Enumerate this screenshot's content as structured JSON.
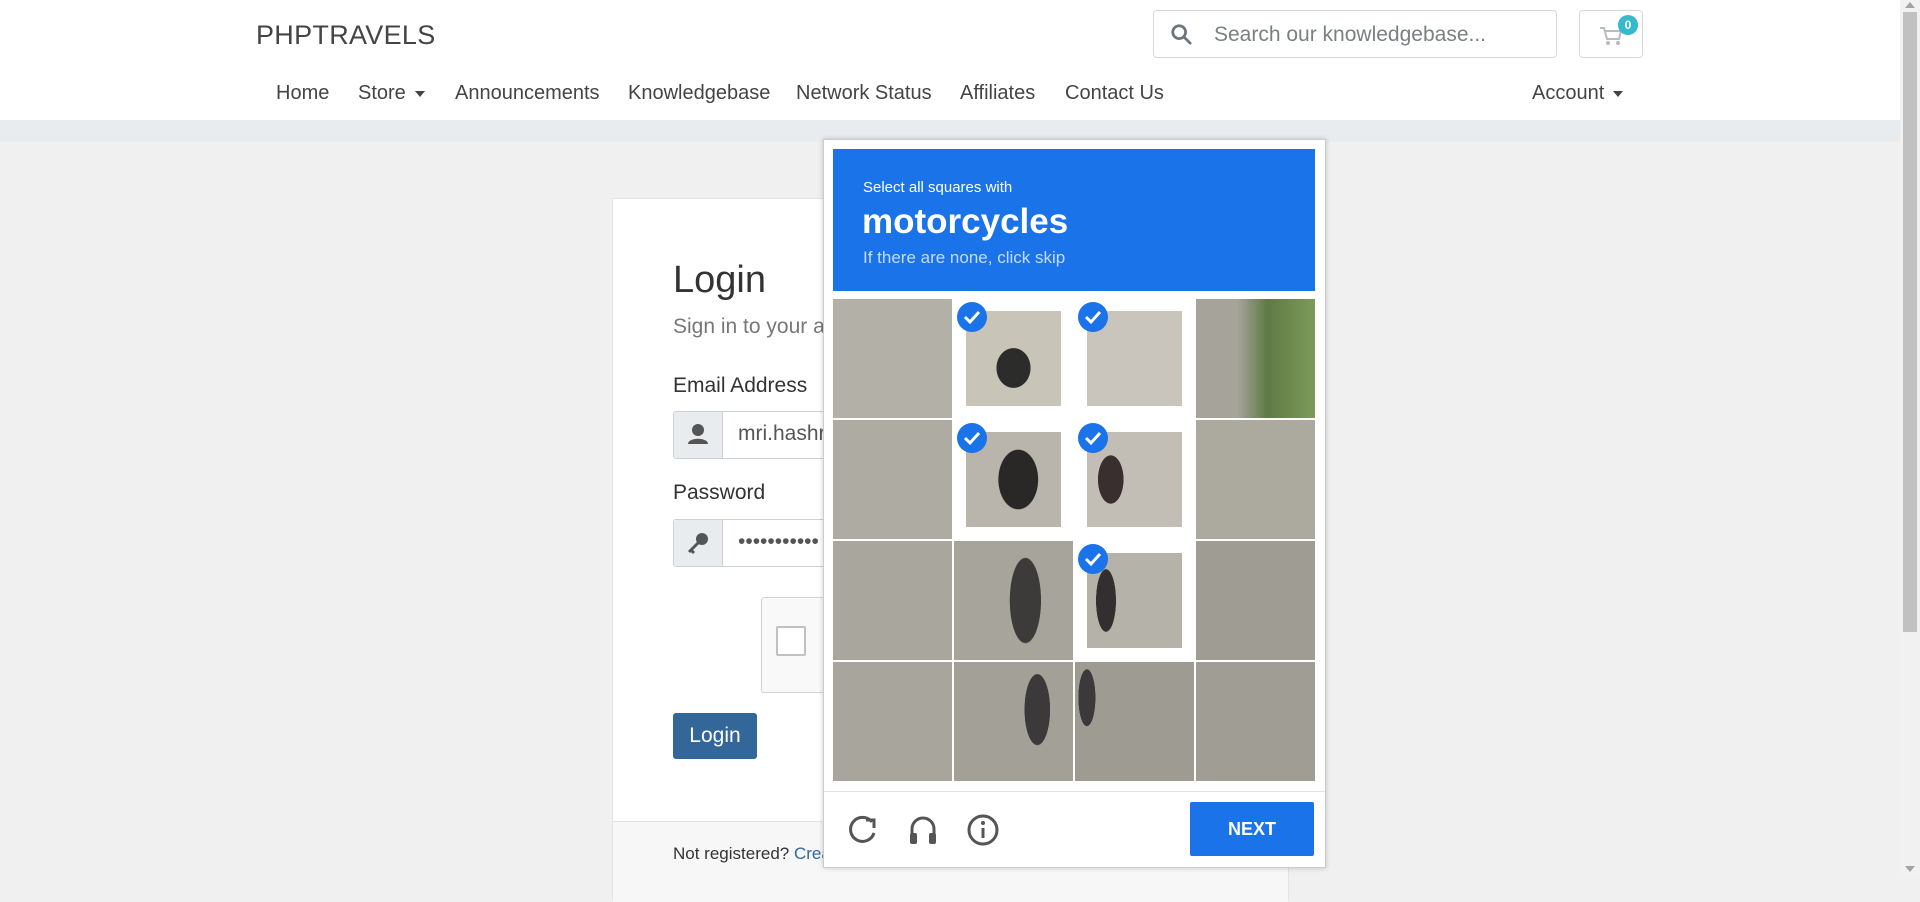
{
  "header": {
    "brand": "PHPTRAVELS",
    "search_placeholder": "Search our knowledgebase...",
    "cart_count": "0",
    "nav": [
      {
        "label": "Home"
      },
      {
        "label": "Store"
      },
      {
        "label": "Announcements"
      },
      {
        "label": "Knowledgebase"
      },
      {
        "label": "Network Status"
      },
      {
        "label": "Affiliates"
      },
      {
        "label": "Contact Us"
      }
    ],
    "account_label": "Account"
  },
  "login": {
    "title": "Login",
    "subtitle": "Sign in to your a",
    "email_label": "Email Address",
    "email_value": "mri.hashr",
    "password_label": "Password",
    "password_value": "•••••••••••",
    "button_label": "Login",
    "footer_text": "Not registered? ",
    "footer_link": "Crea"
  },
  "captcha": {
    "instruction": "Select all squares with",
    "target": "motorcycles",
    "hint": "If there are none, click skip",
    "next_label": "NEXT",
    "selected_tiles": [
      1,
      2,
      5,
      6,
      10
    ],
    "tiles_total": 16
  },
  "colors": {
    "captcha_blue": "#1a73e8",
    "login_button": "#336699",
    "badge": "#36b9cc"
  },
  "icons": [
    "search-icon",
    "cart-icon",
    "user-icon",
    "key-icon",
    "reload-icon",
    "headphones-icon",
    "info-icon",
    "checkmark-icon"
  ]
}
